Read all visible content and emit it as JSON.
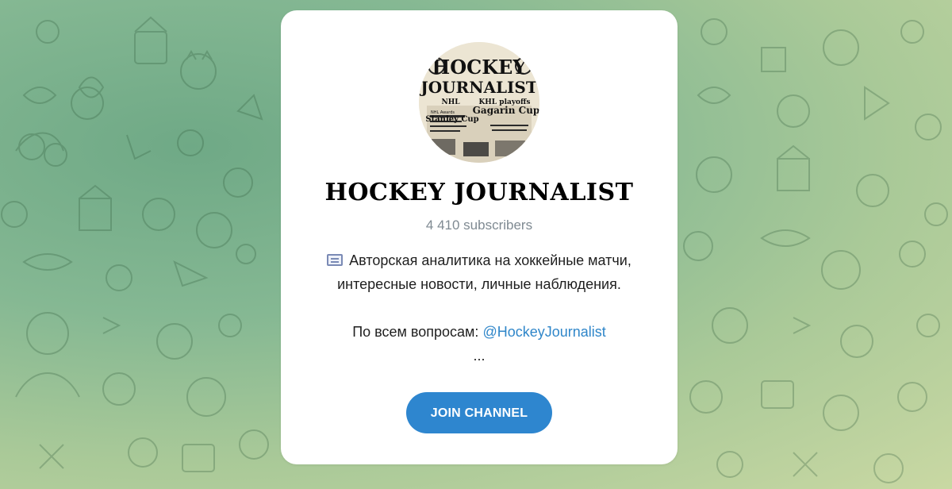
{
  "channel": {
    "name": "HOCKEY JOURNALIST",
    "subscribers": "4 410 subscribers",
    "description": {
      "line1": "Авторская аналитика на хоккейные матчи,",
      "line2": "интересные новости, личные наблюдения.",
      "contact_label": "По всем вопросам:",
      "contact_link": "@HockeyJournalist",
      "more": "..."
    },
    "avatar": {
      "headline1": "HOCKEY",
      "headline2": "JOURNALIST",
      "sub_left": "NHL",
      "sub_right": "KHL playoffs",
      "left_caption": "Stanley Cup",
      "right_caption": "Gagarin Cup",
      "small_caption": "NHL Awards"
    }
  },
  "join_button": {
    "label": "JOIN CHANNEL"
  },
  "icons": {
    "description_emoji": "newspaper-icon"
  },
  "colors": {
    "accent": "#2e86cf",
    "link": "#2f86c9",
    "muted": "#7f8a92"
  }
}
